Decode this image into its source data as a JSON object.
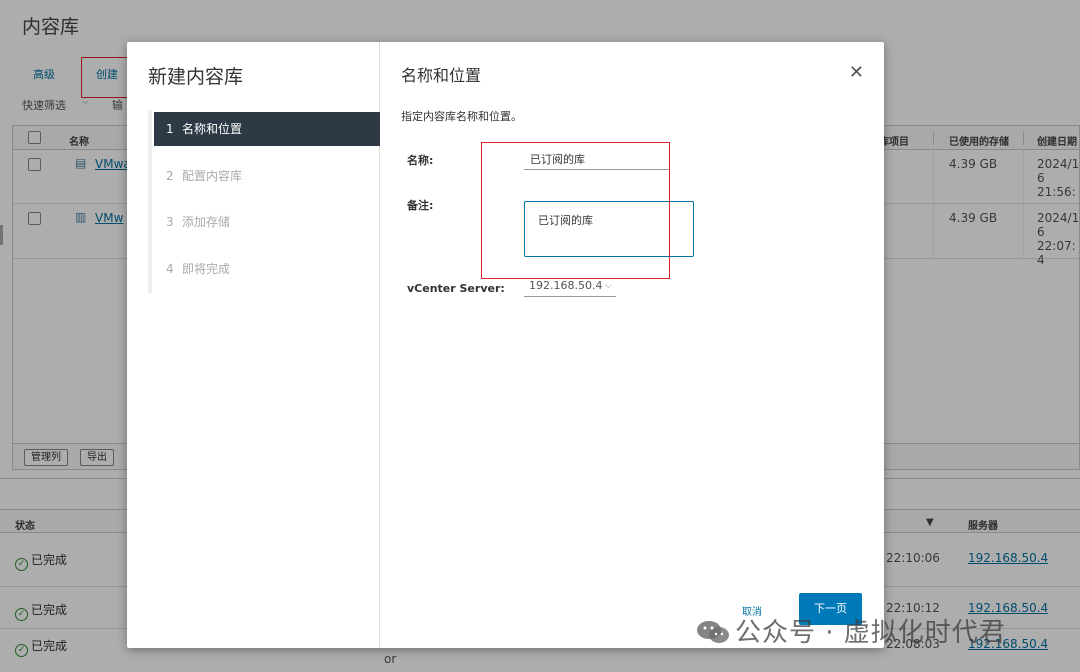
{
  "page": {
    "title": "内容库"
  },
  "toolbar": {
    "advanced": "高级",
    "create": "创建",
    "quick_filter": "快速筛选",
    "export_frag": "输"
  },
  "grid": {
    "headers": {
      "name": "名称",
      "items": "库项目",
      "used": "已使用的存储",
      "created": "创建日期"
    },
    "rows": [
      {
        "name": "VMwa",
        "used": "4.39 GB",
        "created": "2024/11/ 6 21:56:"
      },
      {
        "name": "VMw",
        "used": "4.39 GB",
        "created": "2024/11/ 6 22:07: 4"
      }
    ],
    "footer": {
      "manage_columns": "管理列",
      "export": "导出"
    }
  },
  "tasks": {
    "headers": {
      "status": "状态",
      "server": "服务器"
    },
    "rows": [
      {
        "status": "已完成",
        "time": "22:10:06",
        "server": "192.168.50.4"
      },
      {
        "status": "已完成",
        "time": "22:10:12",
        "server": "192.168.50.4"
      },
      {
        "status": "已完成",
        "time": "22:08:03",
        "server": "192.168.50.4"
      }
    ],
    "partial_text": "or"
  },
  "modal": {
    "title": "新建内容库",
    "steps": [
      {
        "num": "1",
        "label": "名称和位置"
      },
      {
        "num": "2",
        "label": "配置内容库"
      },
      {
        "num": "3",
        "label": "添加存储"
      },
      {
        "num": "4",
        "label": "即将完成"
      }
    ],
    "section_title": "名称和位置",
    "description": "指定内容库名称和位置。",
    "name_label": "名称:",
    "name_value": "已订阅的库",
    "note_label": "备注:",
    "note_value": "已订阅的库",
    "vcenter_label": "vCenter Server:",
    "vcenter_value": "192.168.50.4",
    "cancel": "取消",
    "next": "下一页"
  },
  "watermark": "公众号 · 虚拟化时代君"
}
